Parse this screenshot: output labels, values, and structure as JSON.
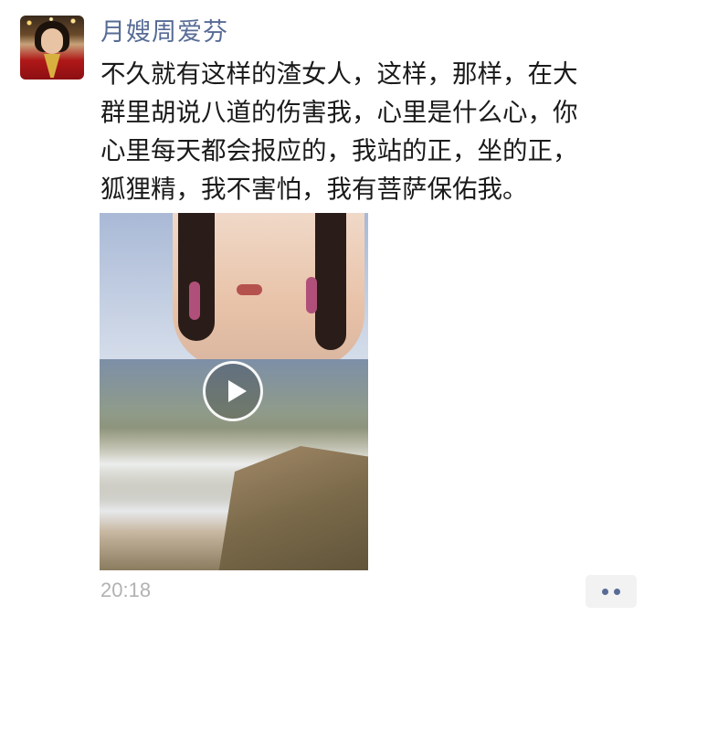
{
  "post": {
    "author": "月嫂周爱芬",
    "text_lines": [
      "不久就有这样的渣女人，这样，那样，在大",
      "群里胡说八道的伤害我，心里是什么心，你",
      "心里每天都会报应的，我站的正，坐的正，",
      "狐狸精，我不害怕，我有菩萨保佑我。"
    ],
    "time": "20:18"
  },
  "icons": {
    "play": "play-icon",
    "more": "more-dots-icon"
  },
  "colors": {
    "author_name": "#576b95",
    "timestamp": "#b2b2b2",
    "more_button_bg": "#f2f2f2"
  }
}
